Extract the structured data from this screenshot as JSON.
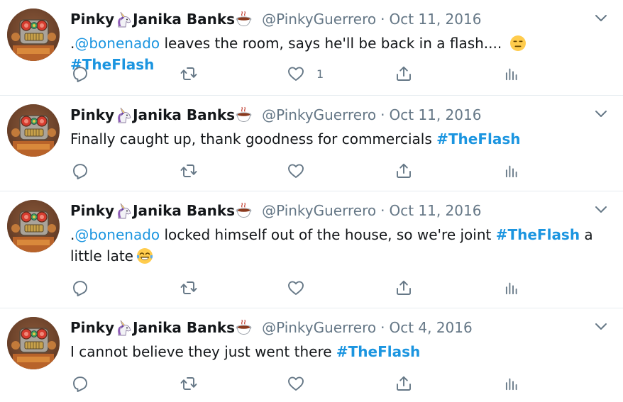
{
  "colors": {
    "link": "#1b95e0",
    "muted": "#657786",
    "text": "#14171a",
    "divider": "#e6ecf0"
  },
  "tweets": [
    {
      "name_a": "Pinky",
      "name_b": "Janika Banks",
      "name_icons": [
        "unicorn-emoji-icon",
        "coffee-emoji-icon"
      ],
      "handle": "@PinkyGuerrero",
      "dot": "·",
      "date": "Oct 11, 2016",
      "text_lead": ".",
      "mention": "@bonenado",
      "text_mid": " leaves the room, says he'll be back in a flash.... ",
      "text_emoji": "expressionless-face-icon",
      "hashtag": "#TheFlash",
      "like_count": "1"
    },
    {
      "name_a": "Pinky",
      "name_b": "Janika Banks",
      "handle": "@PinkyGuerrero",
      "dot": "·",
      "date": "Oct 11, 2016",
      "text": "Finally caught up, thank goodness for commercials ",
      "hashtag": "#TheFlash",
      "like_count": ""
    },
    {
      "name_a": "Pinky",
      "name_b": "Janika Banks",
      "handle": "@PinkyGuerrero",
      "dot": "·",
      "date": "Oct 11, 2016",
      "text_lead": ".",
      "mention": "@bonenado",
      "text_mid": " locked himself out of the house, so we're joint ",
      "hashtag": "#TheFlash",
      "text_tail": " a little late",
      "text_emoji": "face-with-tears-of-joy-icon",
      "like_count": ""
    },
    {
      "name_a": "Pinky",
      "name_b": "Janika Banks",
      "handle": "@PinkyGuerrero",
      "dot": "·",
      "date": "Oct 4, 2016",
      "text": "I cannot believe they just went there ",
      "hashtag": "#TheFlash",
      "like_count": ""
    }
  ]
}
